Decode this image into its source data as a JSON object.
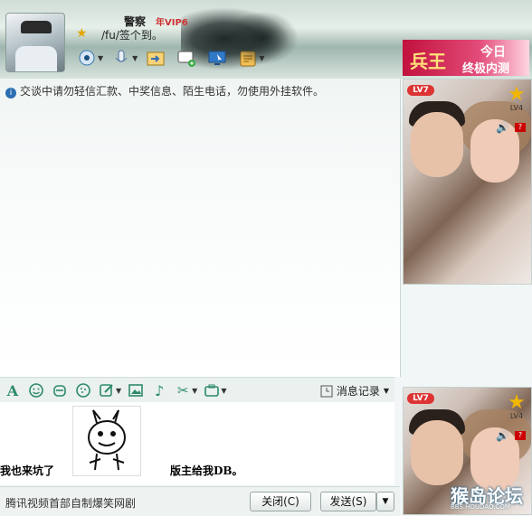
{
  "header": {
    "nickname": "警察",
    "vip_badge": "年VIP6",
    "signature": "/fu/签个到。",
    "toolbar": [
      {
        "name": "webcam-icon"
      },
      {
        "name": "microphone-icon"
      },
      {
        "name": "file-transfer-icon"
      },
      {
        "name": "sms-icon"
      },
      {
        "name": "remote-assist-icon"
      },
      {
        "name": "apps-icon"
      }
    ]
  },
  "ad": {
    "brand": "兵王",
    "line1": "今日",
    "line2": "终极内测"
  },
  "chat": {
    "notice": "交谈中请勿轻信汇款、中奖信息、陌生电话，勿使用外挂软件。"
  },
  "format_bar": {
    "history_label": "消息记录"
  },
  "input": {
    "text_left": "我也来坑了",
    "text_right": "版主给我DB。"
  },
  "bottom": {
    "ticker": "腾讯视频首部自制爆笑网剧",
    "close_label": "关闭(C)",
    "send_label": "发送(S)"
  },
  "side": {
    "lv_badge": "LV7",
    "lv_star": "LV4",
    "speaker_icon": "speaker-icon",
    "q_badge": "?",
    "watermark": "猴岛论坛",
    "watermark_url": "BBS.HOUDAO.COM"
  },
  "colors": {
    "accent": "#2d8a6a",
    "ad_red": "#c2113d"
  }
}
